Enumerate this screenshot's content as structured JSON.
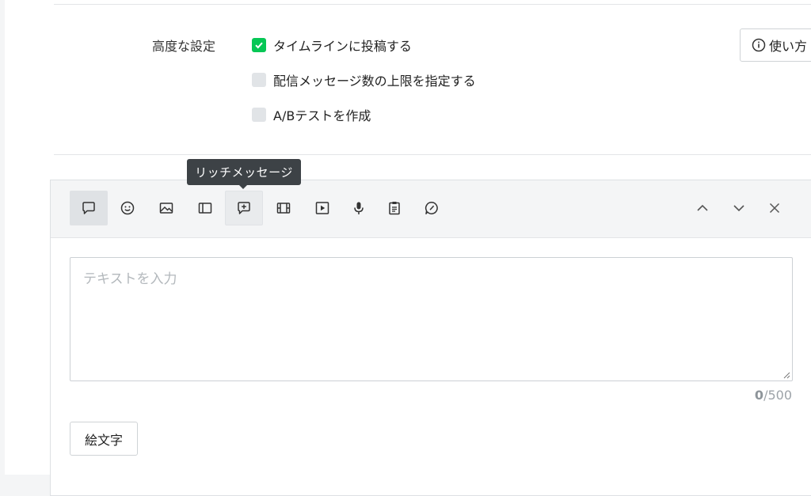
{
  "advanced": {
    "label": "高度な設定",
    "options": [
      {
        "label": "タイムラインに投稿する",
        "checked": true
      },
      {
        "label": "配信メッセージ数の上限を指定する",
        "checked": false
      },
      {
        "label": "A/Bテストを作成",
        "checked": false
      }
    ],
    "usage_button": "使い方"
  },
  "tooltip": "リッチメッセージ",
  "toolbar": {
    "buttons": [
      {
        "icon": "speech-bubble-icon",
        "state": "active"
      },
      {
        "icon": "smiley-icon",
        "state": "normal"
      },
      {
        "icon": "image-icon",
        "state": "normal"
      },
      {
        "icon": "card-icon",
        "state": "normal"
      },
      {
        "icon": "rich-message-icon",
        "state": "hover"
      },
      {
        "icon": "film-icon",
        "state": "normal"
      },
      {
        "icon": "play-icon",
        "state": "normal"
      },
      {
        "icon": "microphone-icon",
        "state": "normal"
      },
      {
        "icon": "clipboard-icon",
        "state": "normal"
      },
      {
        "icon": "pencil-bubble-icon",
        "state": "normal"
      }
    ],
    "controls": [
      "chevron-up-icon",
      "chevron-down-icon",
      "close-icon"
    ]
  },
  "textarea": {
    "placeholder": "テキストを入力",
    "value": ""
  },
  "counter": {
    "current": "0",
    "max": "/500"
  },
  "emoji_button": "絵文字",
  "colors": {
    "accent_green": "#06c755",
    "tooltip_bg": "#3d4246"
  }
}
